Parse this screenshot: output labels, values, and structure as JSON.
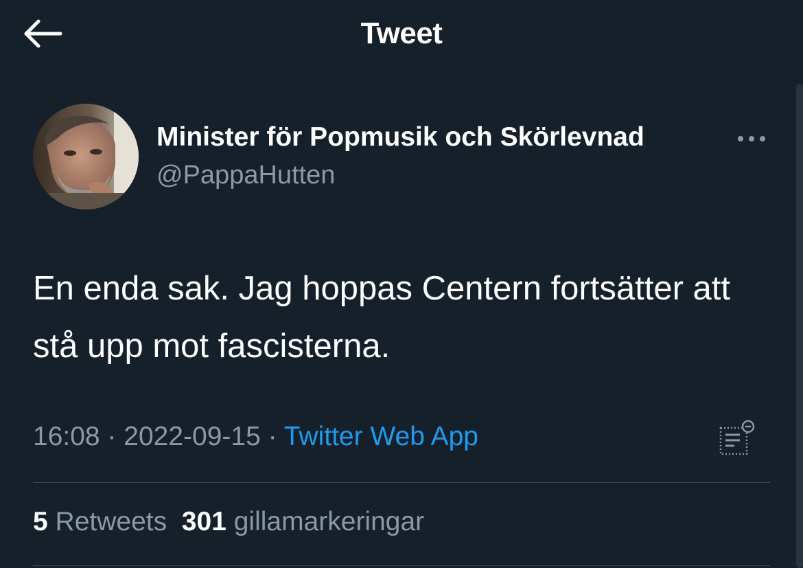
{
  "header": {
    "title": "Tweet",
    "back_icon": "arrow-left-icon"
  },
  "author": {
    "display_name": "Minister för Popmusik och Skörlevnad",
    "handle": "@PappaHutten",
    "more_icon": "more-horizontal-icon"
  },
  "tweet": {
    "text": "En enda sak. Jag hoppas Centern fortsätter att stå upp mot fascisterna.",
    "time": "16:08",
    "separator": " · ",
    "date": "2022-09-15",
    "source": "Twitter Web App",
    "analytics_icon": "analytics-icon"
  },
  "stats": {
    "retweets_count": "5",
    "retweets_label": "Retweets",
    "likes_count": "301",
    "likes_label": "gillamarkeringar"
  },
  "colors": {
    "background": "#16202b",
    "text_primary": "#ffffff",
    "text_secondary": "#8b98a5",
    "link": "#1d9bf0",
    "divider": "#38444d"
  }
}
